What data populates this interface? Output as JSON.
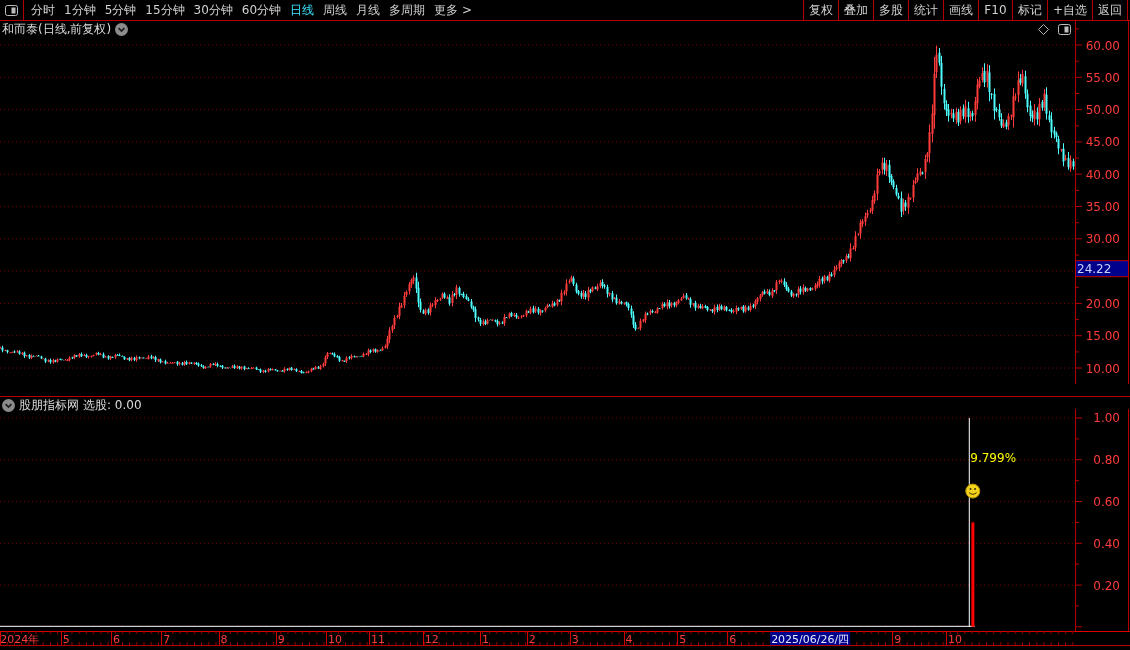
{
  "toolbar": {
    "period_tabs": [
      {
        "label": "分时",
        "selected": false
      },
      {
        "label": "1分钟",
        "selected": false
      },
      {
        "label": "5分钟",
        "selected": false
      },
      {
        "label": "15分钟",
        "selected": false
      },
      {
        "label": "30分钟",
        "selected": false
      },
      {
        "label": "60分钟",
        "selected": false
      },
      {
        "label": "日线",
        "selected": true
      },
      {
        "label": "周线",
        "selected": false
      },
      {
        "label": "月线",
        "selected": false
      },
      {
        "label": "多周期",
        "selected": false
      },
      {
        "label": "更多 >",
        "selected": false
      }
    ],
    "buttons": [
      "复权",
      "叠加",
      "多股",
      "统计",
      "画线",
      "F10",
      "标记",
      "+自选",
      "返回"
    ]
  },
  "price_panel": {
    "title": "和而泰(日线,前复权)",
    "price_labels": [
      "60.00",
      "55.00",
      "50.00",
      "45.00",
      "40.00",
      "35.00",
      "30.00",
      "20.00",
      "15.00",
      "10.00"
    ],
    "cursor_price": "24.22"
  },
  "indicator_panel": {
    "title": "股朋指标网",
    "reading": "选股: 0.00",
    "cursor_date": "2025/06/26/四",
    "chart_data": {
      "type": "bar",
      "grid": true,
      "ylim": [
        -0.02,
        1.043
      ],
      "yticks": [
        {
          "value": 1.0,
          "label": "1.00"
        },
        {
          "value": 0.8,
          "label": "0.80"
        },
        {
          "value": 0.6,
          "label": "0.60"
        },
        {
          "value": 0.4,
          "label": "0.40"
        },
        {
          "value": 0.2,
          "label": "0.20"
        }
      ],
      "categories": [
        null,
        null,
        null,
        null,
        null,
        "2024年",
        null,
        null,
        null,
        null,
        null,
        null,
        null,
        null,
        null,
        null,
        null,
        null,
        "5",
        null,
        null,
        null,
        null,
        null,
        null,
        null,
        null,
        null,
        null,
        null,
        null,
        null,
        "6",
        null,
        null,
        null,
        null,
        null,
        null,
        null,
        null,
        null,
        null,
        null,
        null,
        null,
        "7",
        null,
        null,
        null,
        null,
        null,
        null,
        null,
        null,
        null,
        null,
        null,
        null,
        null,
        null,
        null,
        "8",
        null,
        null,
        null,
        null,
        null,
        null,
        null,
        null,
        null,
        null,
        null,
        null,
        null,
        null,
        null,
        "9",
        null,
        null,
        null,
        null,
        null,
        null,
        null,
        null,
        null,
        null,
        null,
        null,
        null,
        null,
        "10",
        null,
        null,
        null,
        null,
        null,
        null,
        null,
        null,
        null,
        null,
        null,
        "11",
        null,
        null,
        null,
        null,
        null,
        null,
        null,
        null,
        null,
        null,
        null,
        null,
        null,
        null,
        "12",
        null,
        null,
        null,
        null,
        null,
        null,
        null,
        null,
        null,
        null,
        null,
        null,
        null,
        null,
        "1",
        null,
        null,
        null,
        null,
        null,
        null,
        null,
        null,
        null,
        null,
        null,
        null,
        "2",
        null,
        null,
        null,
        null,
        null,
        null,
        null,
        null,
        null,
        null,
        null,
        "3",
        null,
        null,
        null,
        null,
        null,
        null,
        null,
        null,
        null,
        null,
        null,
        null,
        null,
        null,
        "4",
        null,
        null,
        null,
        null,
        null,
        null,
        null,
        null,
        null,
        null,
        null,
        null,
        null,
        null,
        "5",
        null,
        null,
        null,
        null,
        null,
        null,
        null,
        null,
        null,
        null,
        null,
        null,
        null,
        "6",
        null,
        null,
        null,
        null,
        null,
        null,
        null,
        null,
        null,
        null,
        null,
        null,
        null,
        null,
        null,
        null,
        null,
        null,
        null,
        null,
        null,
        null,
        null,
        null,
        null,
        null,
        null,
        null,
        null,
        null,
        null,
        null,
        null,
        null,
        null,
        null,
        null,
        null,
        null,
        null,
        null,
        null,
        null,
        null,
        null,
        "9",
        null,
        null,
        null,
        null,
        null,
        null,
        null,
        null,
        null,
        null,
        null,
        null,
        null,
        null,
        null,
        "10",
        null,
        null,
        null,
        null,
        null,
        null,
        null,
        null,
        null,
        null,
        null,
        null,
        null,
        null,
        null,
        null,
        null,
        null,
        null,
        null,
        null,
        null,
        null,
        null,
        null,
        null,
        null,
        null,
        null,
        null,
        null,
        null,
        null
      ],
      "series": [
        {
          "color": "#ffffff",
          "values": [
            null,
            null,
            null,
            null,
            null,
            null,
            null,
            null,
            null,
            null,
            null,
            null,
            null,
            null,
            null,
            null,
            null,
            null,
            null,
            null,
            null,
            null,
            null,
            null,
            null,
            null,
            null,
            null,
            null,
            null,
            null,
            null,
            null,
            null,
            null,
            null,
            null,
            null,
            null,
            null,
            null,
            null,
            null,
            null,
            null,
            null,
            null,
            null,
            null,
            null,
            null,
            null,
            null,
            null,
            null,
            null,
            null,
            null,
            null,
            null,
            null,
            null,
            null,
            null,
            null,
            null,
            null,
            null,
            null,
            null,
            null,
            null,
            null,
            null,
            null,
            null,
            null,
            null,
            null,
            null,
            null,
            null,
            null,
            null,
            null,
            null,
            null,
            null,
            null,
            null,
            null,
            null,
            null,
            null,
            null,
            null,
            null,
            null,
            null,
            null,
            null,
            null,
            null,
            null,
            null,
            null,
            null,
            null,
            null,
            null,
            null,
            null,
            null,
            null,
            null,
            null,
            null,
            null,
            null,
            null,
            null,
            null,
            null,
            null,
            null,
            null,
            null,
            null,
            null,
            null,
            null,
            null,
            null,
            null,
            null,
            null,
            null,
            null,
            null,
            null,
            null,
            null,
            null,
            null,
            null,
            null,
            null,
            null,
            null,
            null,
            null,
            null,
            null,
            null,
            null,
            null,
            null,
            null,
            null,
            null,
            null,
            null,
            null,
            null,
            null,
            null,
            null,
            null,
            null,
            null,
            null,
            null,
            null,
            null,
            null,
            null,
            null,
            null,
            null,
            null,
            null,
            null,
            null,
            null,
            null,
            null,
            null,
            null,
            null,
            null,
            null,
            null,
            null,
            null,
            null,
            null,
            null,
            null,
            null,
            null,
            null,
            null,
            null,
            null,
            null,
            null,
            null,
            null,
            null,
            null,
            null,
            null,
            null,
            null,
            null,
            null,
            null,
            null,
            null,
            null,
            null,
            null,
            null,
            null,
            null,
            null,
            null,
            null,
            null,
            null,
            null,
            null,
            null,
            null,
            null,
            null,
            null,
            null,
            null,
            null,
            null,
            null,
            null,
            null,
            null,
            null,
            null,
            null,
            null,
            null,
            null,
            null,
            null,
            null,
            null,
            null,
            null,
            null,
            null,
            null,
            null,
            null,
            null,
            null,
            null,
            null,
            null,
            null,
            null,
            null,
            1.0,
            null,
            null,
            null,
            null,
            null,
            null,
            null,
            null,
            null,
            null,
            null,
            null,
            null,
            null,
            null,
            null,
            null,
            null,
            null,
            null,
            null,
            null,
            null,
            null,
            null,
            null,
            null,
            null,
            null
          ]
        },
        {
          "color": "#ff0000",
          "values": [
            null,
            null,
            null,
            null,
            null,
            null,
            null,
            null,
            null,
            null,
            null,
            null,
            null,
            null,
            null,
            null,
            null,
            null,
            null,
            null,
            null,
            null,
            null,
            null,
            null,
            null,
            null,
            null,
            null,
            null,
            null,
            null,
            null,
            null,
            null,
            null,
            null,
            null,
            null,
            null,
            null,
            null,
            null,
            null,
            null,
            null,
            null,
            null,
            null,
            null,
            null,
            null,
            null,
            null,
            null,
            null,
            null,
            null,
            null,
            null,
            null,
            null,
            null,
            null,
            null,
            null,
            null,
            null,
            null,
            null,
            null,
            null,
            null,
            null,
            null,
            null,
            null,
            null,
            null,
            null,
            null,
            null,
            null,
            null,
            null,
            null,
            null,
            null,
            null,
            null,
            null,
            null,
            null,
            null,
            null,
            null,
            null,
            null,
            null,
            null,
            null,
            null,
            null,
            null,
            null,
            null,
            null,
            null,
            null,
            null,
            null,
            null,
            null,
            null,
            null,
            null,
            null,
            null,
            null,
            null,
            null,
            null,
            null,
            null,
            null,
            null,
            null,
            null,
            null,
            null,
            null,
            null,
            null,
            null,
            null,
            null,
            null,
            null,
            null,
            null,
            null,
            null,
            null,
            null,
            null,
            null,
            null,
            null,
            null,
            null,
            null,
            null,
            null,
            null,
            null,
            null,
            null,
            null,
            null,
            null,
            null,
            null,
            null,
            null,
            null,
            null,
            null,
            null,
            null,
            null,
            null,
            null,
            null,
            null,
            null,
            null,
            null,
            null,
            null,
            null,
            null,
            null,
            null,
            null,
            null,
            null,
            null,
            null,
            null,
            null,
            null,
            null,
            null,
            null,
            null,
            null,
            null,
            null,
            null,
            null,
            null,
            null,
            null,
            null,
            null,
            null,
            null,
            null,
            null,
            null,
            null,
            null,
            null,
            null,
            null,
            null,
            null,
            null,
            null,
            null,
            null,
            null,
            null,
            null,
            null,
            null,
            null,
            null,
            null,
            null,
            null,
            null,
            null,
            null,
            null,
            null,
            null,
            null,
            null,
            null,
            null,
            null,
            null,
            null,
            null,
            null,
            null,
            null,
            null,
            null,
            null,
            null,
            null,
            null,
            null,
            null,
            null,
            null,
            null,
            null,
            null,
            null,
            null,
            null,
            null,
            null,
            null,
            null,
            null,
            null,
            null,
            0.5,
            null,
            null,
            null,
            null,
            null,
            null,
            null,
            null,
            null,
            null,
            null,
            null,
            null,
            null,
            null,
            null,
            null,
            null,
            null,
            null,
            null,
            null,
            null,
            null,
            null,
            null,
            null,
            null
          ]
        }
      ],
      "annotations": [
        "9.799%"
      ]
    }
  }
}
